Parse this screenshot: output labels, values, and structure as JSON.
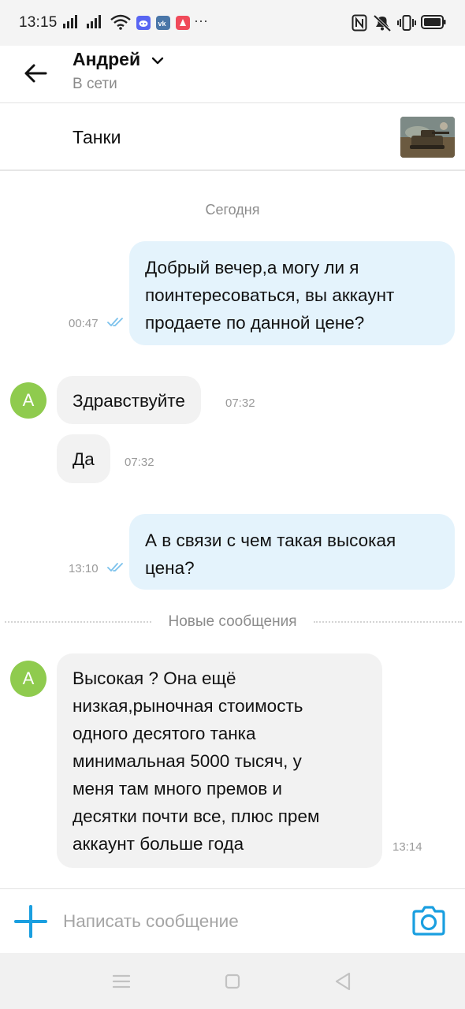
{
  "status_bar": {
    "time": "13:15",
    "dots": "···",
    "icons": [
      "signal-icon",
      "signal-icon",
      "wifi-icon",
      "discord-icon",
      "vk-icon",
      "app-icon",
      "nfc-icon",
      "mute-icon",
      "vibrate-icon",
      "battery-icon"
    ]
  },
  "header": {
    "contact_name": "Андрей",
    "contact_status": "В сети"
  },
  "item": {
    "title": "Танки"
  },
  "chat": {
    "date_separator": "Сегодня",
    "new_messages_separator": "Новые сообщения",
    "messages": [
      {
        "direction": "out",
        "text": "Добрый вечер,а могу ли я поинтересоваться, вы аккаунт продаете по данной цене?",
        "lines": [
          "Добрый вечер,а могу ли я",
          "поинтересоваться, вы аккаунт",
          "продаете по данной цене?"
        ],
        "time": "00:47",
        "read": true
      },
      {
        "direction": "in",
        "text": "Здравствуйте",
        "time": "07:32",
        "avatar_letter": "А"
      },
      {
        "direction": "in",
        "text": "Да",
        "time": "07:32"
      },
      {
        "direction": "out",
        "text": "А в связи с чем такая высокая цена?",
        "lines": [
          "А в связи с чем такая высокая",
          "цена?"
        ],
        "time": "13:10",
        "read": true
      },
      {
        "direction": "in",
        "text": "Высокая ? Она ещё низкая,рыночная стоимость одного десятого танка минимальная 5000 тысяч, у меня там много премов и десятки почти все, плюс прем аккаунт больше года",
        "lines": [
          "Высокая ? Она ещё",
          "низкая,рыночная стоимость",
          "одного десятого танка",
          "минимальная 5000 тысяч, у",
          "меня там много премов и",
          "десятки почти все, плюс прем",
          "аккаунт больше года"
        ],
        "time": "13:14",
        "avatar_letter": "А"
      }
    ]
  },
  "composer": {
    "placeholder": "Написать сообщение"
  },
  "colors": {
    "accent": "#1a9fe0",
    "outgoing_bubble": "#e4f3fc",
    "incoming_bubble": "#f2f2f2",
    "avatar": "#8fcb4e",
    "read_ticks": "#7cc2ec"
  }
}
